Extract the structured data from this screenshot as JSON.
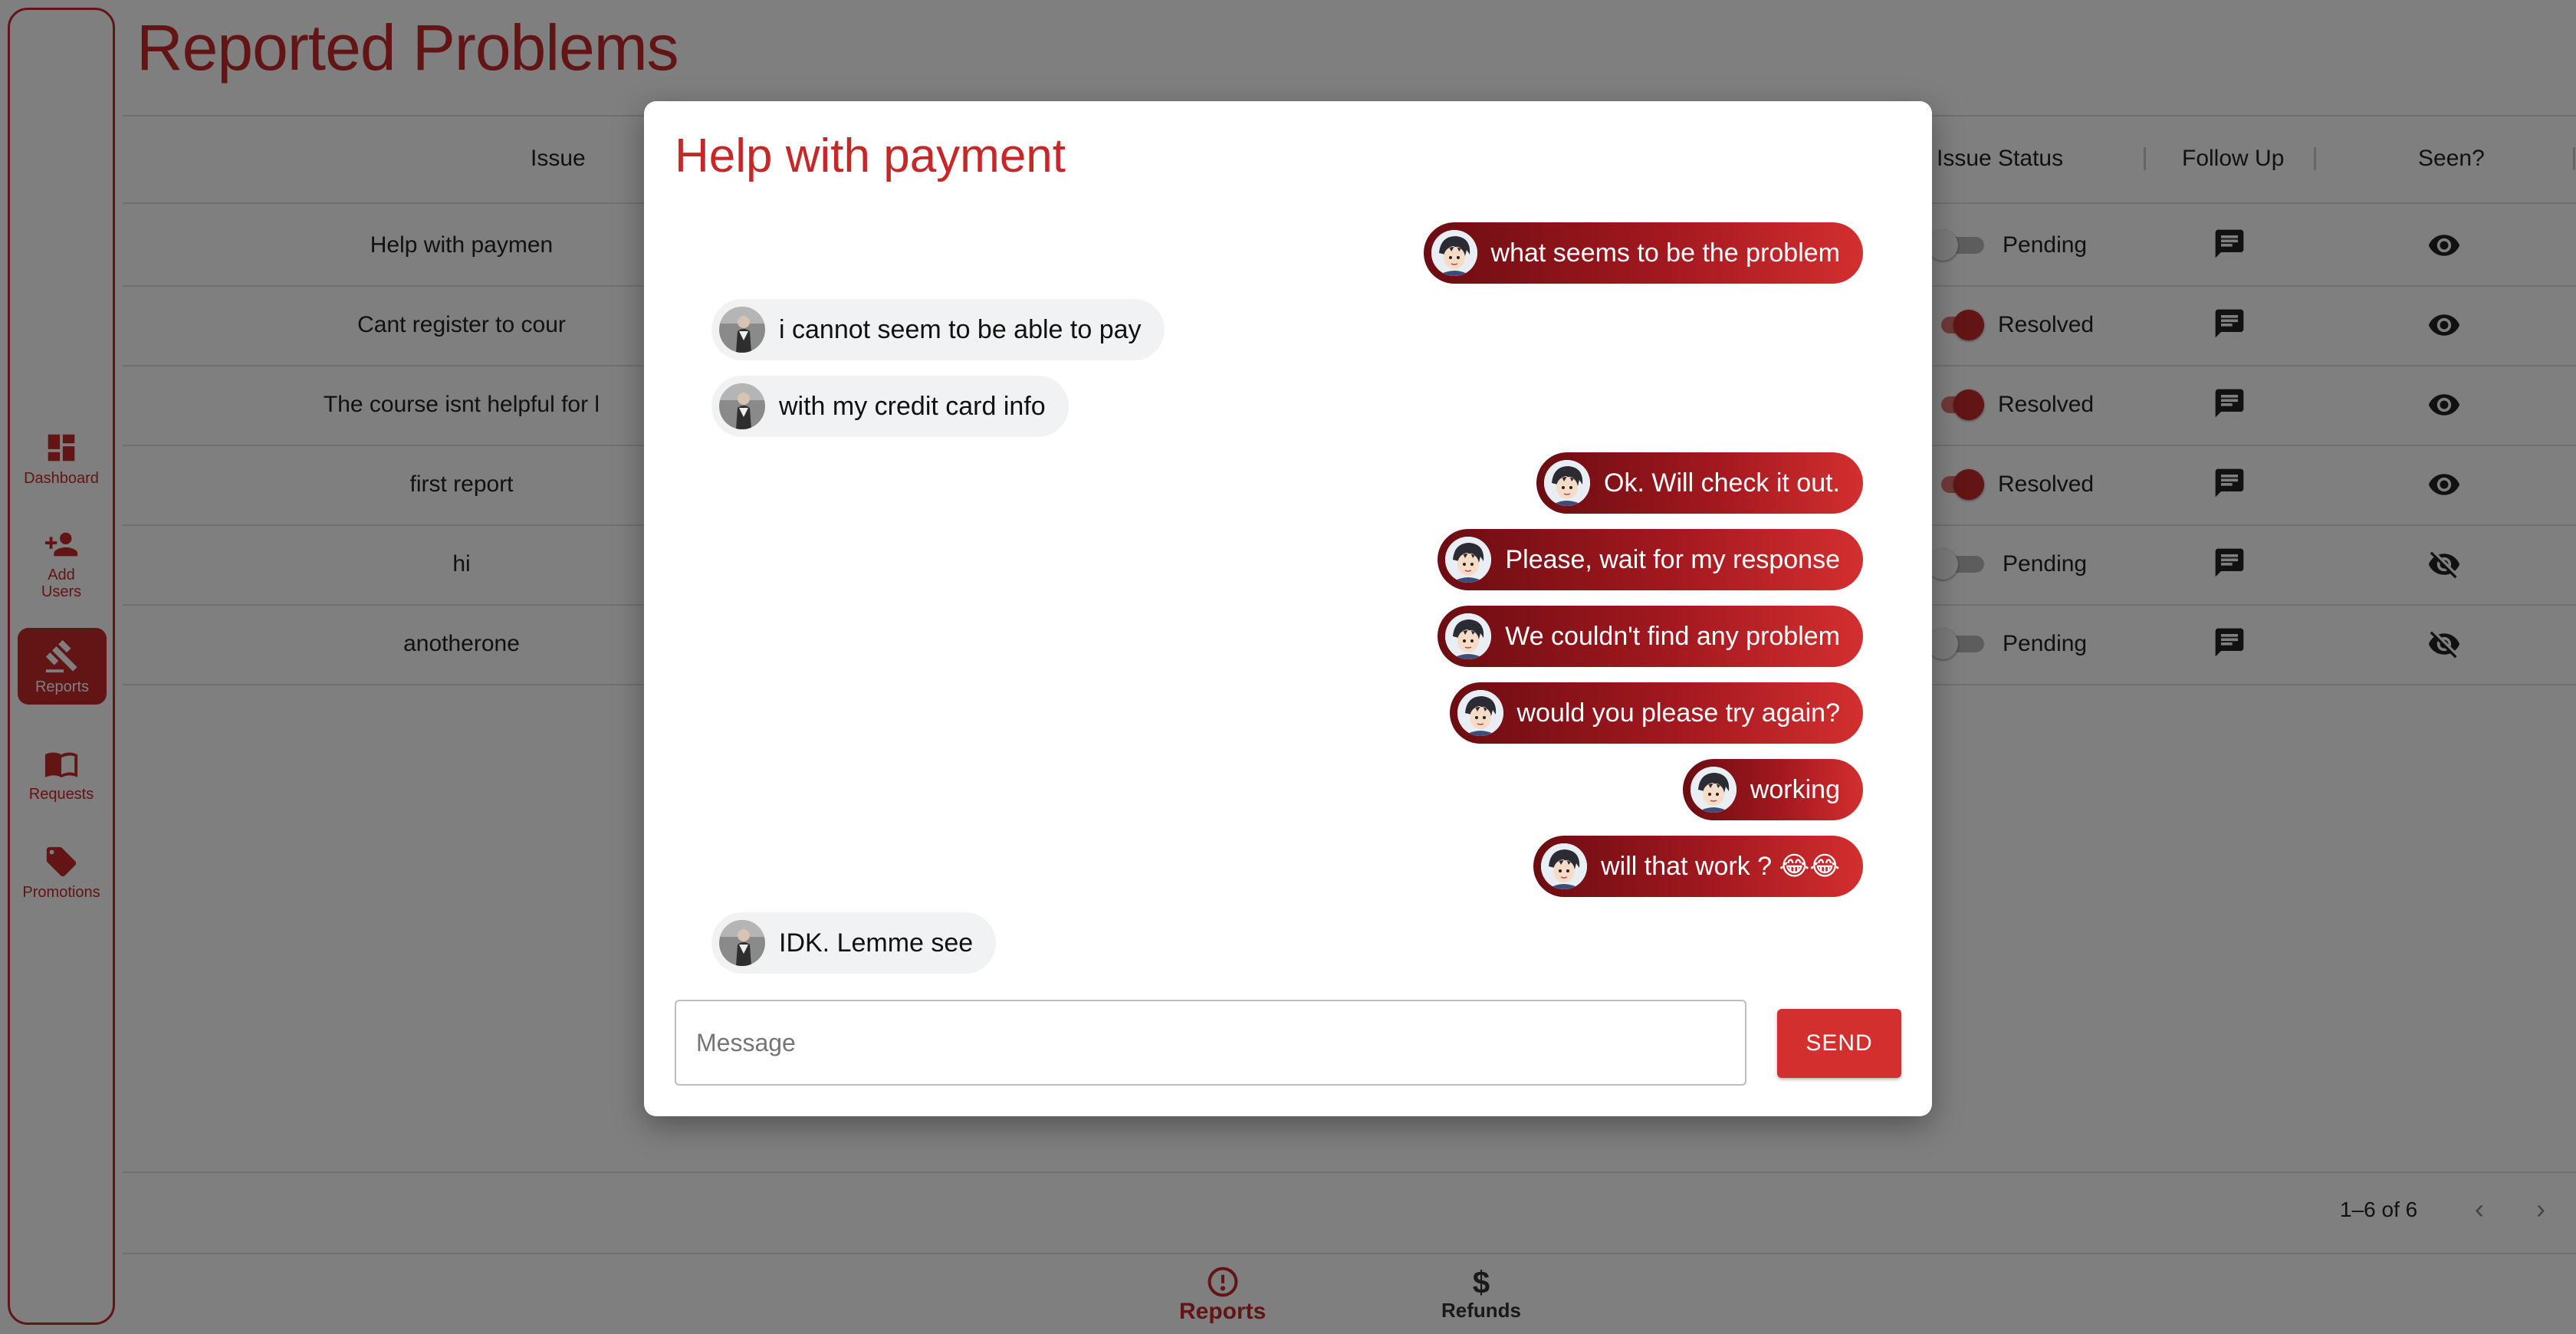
{
  "sidebar": {
    "items": [
      {
        "label": "Dashboard",
        "icon": "dashboard-icon"
      },
      {
        "label": "Add Users",
        "icon": "add-user-icon"
      },
      {
        "label": "Reports",
        "icon": "gavel-icon",
        "active": true
      },
      {
        "label": "Requests",
        "icon": "book-icon"
      },
      {
        "label": "Promotions",
        "icon": "tag-icon"
      }
    ]
  },
  "page": {
    "title": "Reported Problems"
  },
  "table": {
    "headers": {
      "issue": "Issue",
      "status": "Issue Status",
      "follow_up": "Follow Up",
      "seen": "Seen?"
    },
    "rows": [
      {
        "issue": "Help with paymen",
        "status": "Pending",
        "resolved": false,
        "seen": true
      },
      {
        "issue": "Cant register to cour",
        "status": "Resolved",
        "resolved": true,
        "seen": true
      },
      {
        "issue": "The course isnt helpful for l",
        "status": "Resolved",
        "resolved": true,
        "seen": true
      },
      {
        "issue": "first report",
        "status": "Resolved",
        "resolved": true,
        "seen": true
      },
      {
        "issue": "hi",
        "status": "Pending",
        "resolved": false,
        "seen": false
      },
      {
        "issue": "anotherone",
        "status": "Pending",
        "resolved": false,
        "seen": false
      }
    ],
    "pagination": "1–6 of 6"
  },
  "bottom_nav": {
    "reports": "Reports",
    "refunds": "Refunds"
  },
  "modal": {
    "title": "Help with payment",
    "messages": [
      {
        "from": "me",
        "text": "what seems to be the problem"
      },
      {
        "from": "them",
        "text": "i cannot seem to be able to pay"
      },
      {
        "from": "them",
        "text": "with my credit card info"
      },
      {
        "from": "me",
        "text": "Ok. Will check it out."
      },
      {
        "from": "me",
        "text": "Please, wait for my response"
      },
      {
        "from": "me",
        "text": "We couldn't find any problem"
      },
      {
        "from": "me",
        "text": "would you please try again?"
      },
      {
        "from": "me",
        "text": "working"
      },
      {
        "from": "me",
        "text": "will that work ? 😂😂"
      },
      {
        "from": "them",
        "text": "IDK. Lemme see"
      }
    ],
    "input_placeholder": "Message",
    "send_label": "SEND"
  },
  "colors": {
    "accent": "#c62828",
    "send": "#d32f2f"
  }
}
